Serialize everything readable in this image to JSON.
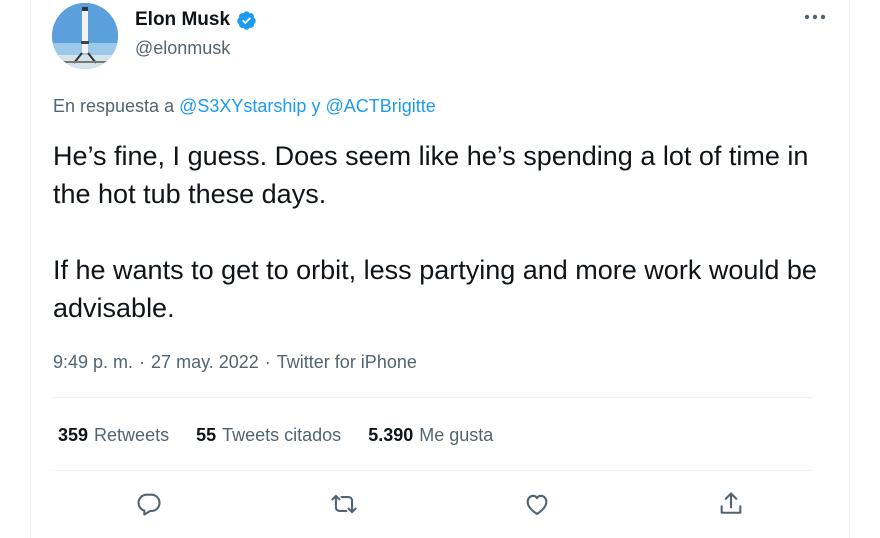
{
  "author": {
    "name": "Elon Musk",
    "handle": "@elonmusk",
    "verified_icon": "verified-badge-icon",
    "accent_color": "#1d9bf0"
  },
  "reply_to": {
    "prefix": "En respuesta a",
    "user1": "@S3XYstarship",
    "joiner": "y",
    "user2": "@ACTBrigitte"
  },
  "tweet": {
    "paragraph1": "He’s fine, I guess. Does seem like he’s spending a lot of time in the hot tub these days.",
    "paragraph2": "If he wants to get to orbit, less partying and more work would be advisable."
  },
  "meta": {
    "time": "9:49 p. m.",
    "separator": "·",
    "date": "27 may. 2022",
    "source": "Twitter for iPhone"
  },
  "stats": {
    "retweets_count": "359",
    "retweets_label": "Retweets",
    "quotes_count": "55",
    "quotes_label": "Tweets citados",
    "likes_count": "5.390",
    "likes_label": "Me gusta"
  },
  "actions": {
    "reply_icon": "reply-icon",
    "retweet_icon": "retweet-icon",
    "like_icon": "heart-icon",
    "share_icon": "share-icon"
  }
}
